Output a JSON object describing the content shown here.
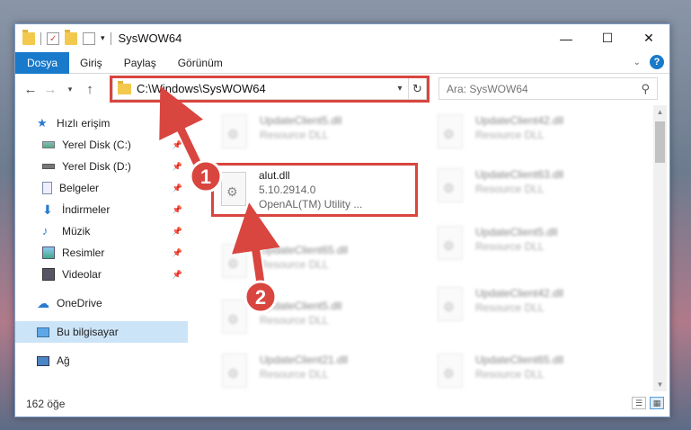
{
  "window": {
    "title": "SysWOW64",
    "controls": {
      "minimize": "—",
      "maximize": "☐",
      "close": "✕"
    }
  },
  "ribbon": {
    "tabs": [
      {
        "label": "Dosya",
        "active": true
      },
      {
        "label": "Giriş",
        "active": false
      },
      {
        "label": "Paylaş",
        "active": false
      },
      {
        "label": "Görünüm",
        "active": false
      }
    ],
    "help": "?"
  },
  "nav": {
    "address": "C:\\Windows\\SysWOW64",
    "search_placeholder": "Ara: SysWOW64"
  },
  "sidebar": {
    "items": [
      {
        "label": "Hızlı erişim",
        "icon": "star-icon"
      },
      {
        "label": "Yerel Disk (C:)",
        "icon": "drive-icon"
      },
      {
        "label": "Yerel Disk (D:)",
        "icon": "drive-icon"
      },
      {
        "label": "Belgeler",
        "icon": "documents-icon"
      },
      {
        "label": "İndirmeler",
        "icon": "download-icon"
      },
      {
        "label": "Müzik",
        "icon": "music-icon"
      },
      {
        "label": "Resimler",
        "icon": "pictures-icon"
      },
      {
        "label": "Videolar",
        "icon": "videos-icon"
      },
      {
        "label": "OneDrive",
        "icon": "cloud-icon"
      },
      {
        "label": "Bu bilgisayar",
        "icon": "computer-icon"
      },
      {
        "label": "Ağ",
        "icon": "network-icon"
      }
    ]
  },
  "files": {
    "focus": {
      "name": "alut.dll",
      "version": "5.10.2914.0",
      "desc": "OpenAL(TM) Utility ..."
    },
    "left": [
      {
        "name": "UpdateClient5.dll",
        "desc": "Resource DLL"
      },
      {
        "name": "UpdateClient65.dll",
        "desc": "Resource DLL"
      },
      {
        "name": "UpdateClient5.dll",
        "desc": "Resource DLL"
      },
      {
        "name": "UpdateClient21.dll",
        "desc": "Resource DLL"
      }
    ],
    "right": [
      {
        "name": "UpdateClient42.dll",
        "desc": "Resource DLL"
      },
      {
        "name": "UpdateClient63.dll",
        "desc": "Resource DLL"
      },
      {
        "name": "UpdateClient5.dll",
        "desc": "Resource DLL"
      },
      {
        "name": "UpdateClient42.dll",
        "desc": "Resource DLL"
      },
      {
        "name": "UpdateClient65.dll",
        "desc": "Resource DLL"
      }
    ]
  },
  "status": {
    "count": "162 öğe"
  },
  "annotations": {
    "step1": "1",
    "step2": "2",
    "color": "#d9453f"
  }
}
